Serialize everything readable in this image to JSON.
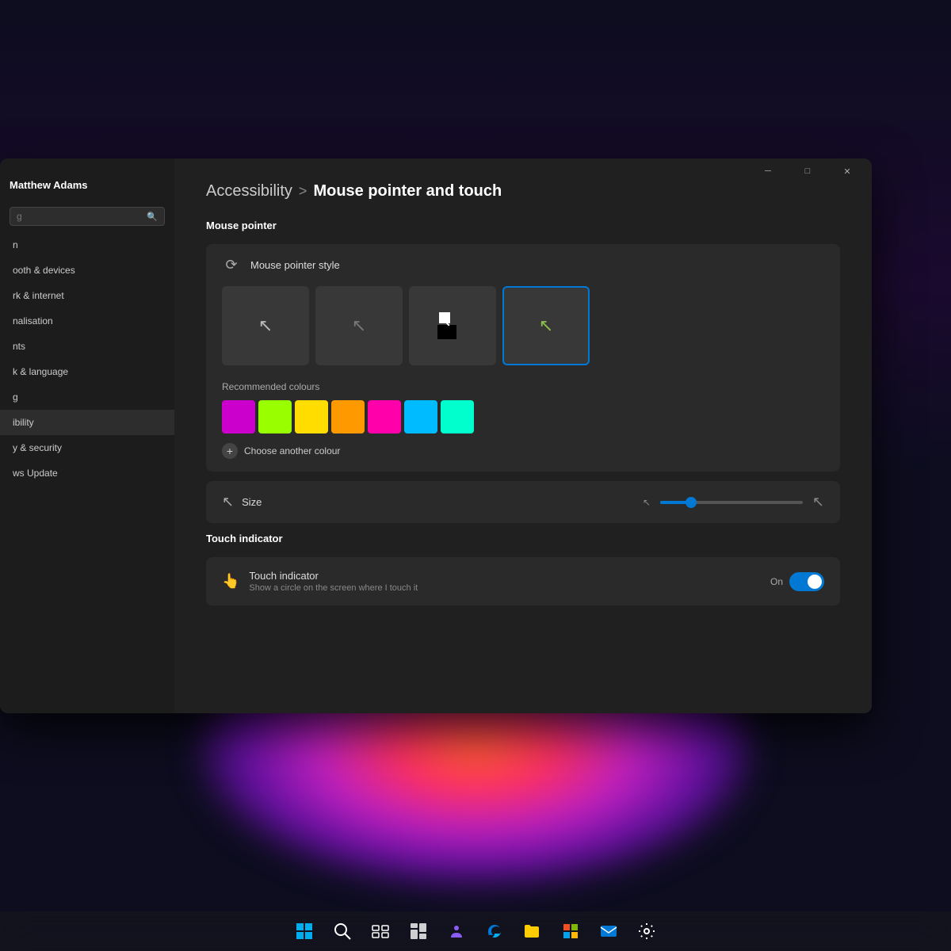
{
  "desktop": {
    "background_desc": "Dark purple gradient desktop"
  },
  "window": {
    "title": "Settings",
    "titlebar_buttons": [
      "minimize",
      "maximize",
      "close"
    ]
  },
  "sidebar": {
    "user_name": "Matthew Adams",
    "search_placeholder": "g",
    "items": [
      {
        "label": "n",
        "id": "system"
      },
      {
        "label": "ooth & devices",
        "id": "bluetooth"
      },
      {
        "label": "rk & internet",
        "id": "network"
      },
      {
        "label": "nalisation",
        "id": "personalisation"
      },
      {
        "label": "nts",
        "id": "accounts"
      },
      {
        "label": "k & language",
        "id": "time"
      },
      {
        "label": "g",
        "id": "gaming"
      },
      {
        "label": "ibility",
        "id": "accessibility",
        "active": true
      },
      {
        "label": "y & security",
        "id": "privacy"
      },
      {
        "label": "ws Update",
        "id": "windows-update"
      }
    ]
  },
  "breadcrumb": {
    "parent": "Accessibility",
    "separator": ">",
    "current": "Mouse pointer and touch"
  },
  "mouse_pointer_section": {
    "title": "Mouse pointer",
    "style_card": {
      "header_label": "Mouse pointer style",
      "options": [
        {
          "id": "white",
          "label": "White cursor",
          "selected": false
        },
        {
          "id": "dark-outline",
          "label": "Dark outline cursor",
          "selected": false
        },
        {
          "id": "inverted",
          "label": "Inverted cursor",
          "selected": false
        },
        {
          "id": "custom",
          "label": "Custom color cursor",
          "selected": true
        }
      ]
    },
    "colors": {
      "label": "Recommended colours",
      "swatches": [
        {
          "color": "#cc00cc",
          "label": "Magenta"
        },
        {
          "color": "#99ff00",
          "label": "Lime"
        },
        {
          "color": "#ffdd00",
          "label": "Yellow"
        },
        {
          "color": "#ff9900",
          "label": "Orange"
        },
        {
          "color": "#ff00aa",
          "label": "Hot pink"
        },
        {
          "color": "#00bbff",
          "label": "Cyan"
        },
        {
          "color": "#00ffcc",
          "label": "Turquoise"
        }
      ],
      "choose_another": "Choose another colour"
    },
    "size": {
      "label": "Size",
      "slider_value": 20
    }
  },
  "touch_indicator_section": {
    "title": "Touch indicator",
    "card": {
      "title": "Touch indicator",
      "subtitle": "Show a circle on the screen where I touch it",
      "toggle_label": "On",
      "toggle_state": true
    }
  },
  "taskbar": {
    "icons": [
      {
        "name": "start-menu",
        "symbol": "⊞"
      },
      {
        "name": "search",
        "symbol": "🔍"
      },
      {
        "name": "task-view",
        "symbol": "❑"
      },
      {
        "name": "widgets",
        "symbol": "▦"
      },
      {
        "name": "teams",
        "symbol": "👥"
      },
      {
        "name": "edge",
        "symbol": "🌐"
      },
      {
        "name": "file-explorer",
        "symbol": "📁"
      },
      {
        "name": "microsoft-store",
        "symbol": "🏪"
      },
      {
        "name": "mail",
        "symbol": "✉"
      },
      {
        "name": "settings",
        "symbol": "⚙"
      }
    ]
  }
}
